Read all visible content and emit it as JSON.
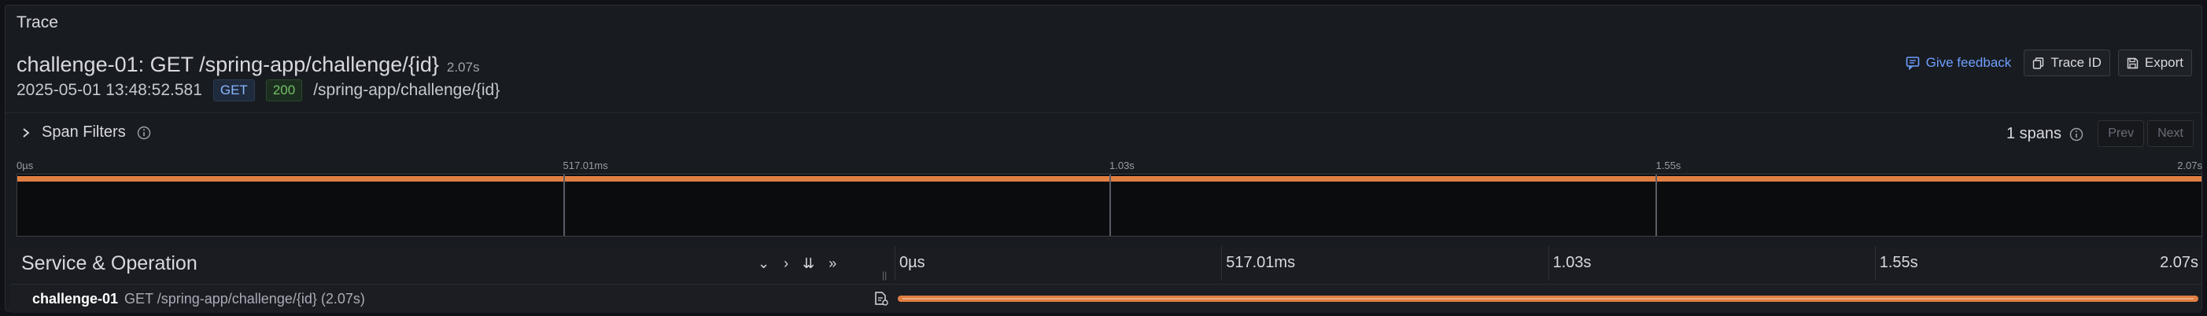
{
  "panel": {
    "title": "Trace"
  },
  "trace": {
    "title": "challenge-01: GET /spring-app/challenge/{id}",
    "duration": "2.07s",
    "start_time": "2025-05-01 13:48:52.581",
    "method": "GET",
    "status": "200",
    "url": "/spring-app/challenge/{id}"
  },
  "actions": {
    "feedback_label": "Give feedback",
    "trace_id_label": "Trace ID",
    "export_label": "Export"
  },
  "filters": {
    "label": "Span Filters",
    "spans_count": "1 spans",
    "prev_label": "Prev",
    "next_label": "Next"
  },
  "minimap": {
    "ticks": [
      "0µs",
      "517.01ms",
      "1.03s",
      "1.55s",
      "2.07s"
    ]
  },
  "timeline": {
    "header_title": "Service & Operation",
    "collapse_controls": [
      "⌄",
      "›",
      "⇊",
      "»"
    ],
    "ticks": [
      "0µs",
      "517.01ms",
      "1.03s",
      "1.55s",
      "2.07s"
    ]
  },
  "spans": [
    {
      "service": "challenge-01",
      "operation": "GET /spring-app/challenge/{id} (2.07s)",
      "start_fraction": 0,
      "end_fraction": 1
    }
  ],
  "colors": {
    "span": "#e07f42",
    "link": "#6e9fff"
  },
  "icons": [
    "feedback-icon",
    "copy-icon",
    "save-icon",
    "chevron-right-icon",
    "info-icon",
    "log-icon"
  ]
}
